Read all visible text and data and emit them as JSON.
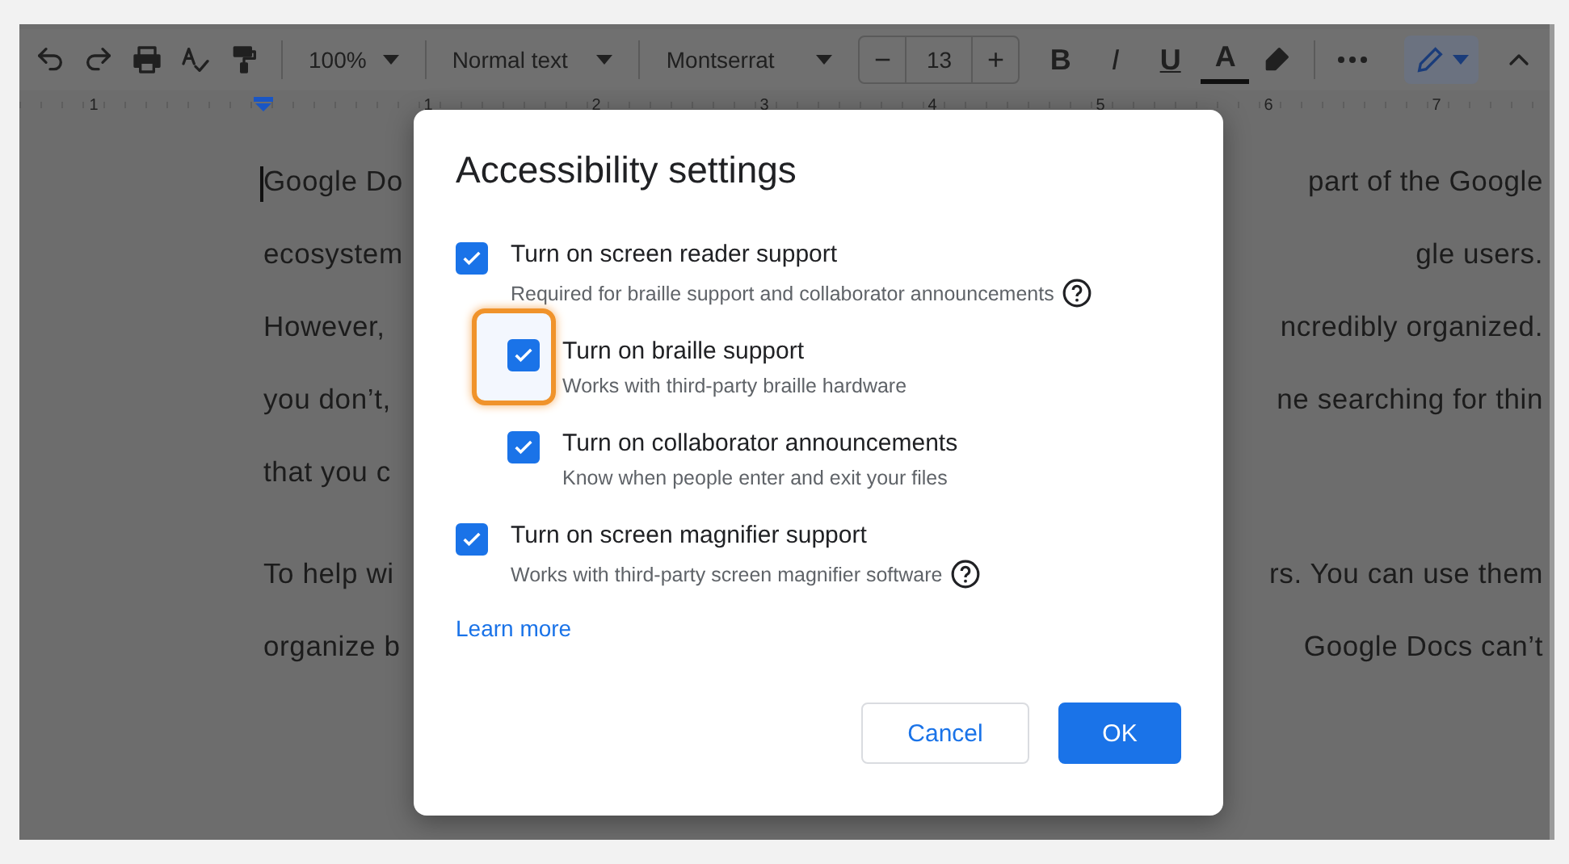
{
  "toolbar": {
    "zoom": "100%",
    "style": "Normal text",
    "font": "Montserrat",
    "font_size": {
      "minus": "−",
      "value": "13",
      "plus": "+"
    },
    "format_keys": [
      {
        "kind": "bold",
        "label": "B"
      },
      {
        "kind": "italic",
        "label": "I"
      },
      {
        "kind": "underline",
        "label": "U"
      },
      {
        "kind": "color",
        "label": "A"
      }
    ]
  },
  "ruler": {
    "numbers": [
      "1",
      "1",
      "2",
      "3",
      "4",
      "5",
      "6",
      "7"
    ]
  },
  "document": {
    "lines": [
      {
        "left": "Google Do",
        "right": "part of the Google",
        "cursor": true
      },
      {
        "left": "ecosystem",
        "right": "gle users.",
        "cursor": false
      },
      {
        "left": "However, ",
        "right": "ncredibly organized.",
        "cursor": false
      },
      {
        "left": "you don’t,",
        "right": "ne searching for thin",
        "cursor": false
      },
      {
        "left": "that you c",
        "cursor": false
      },
      {
        "left": "To help wi",
        "right": "rs. You can use them",
        "cursor": false,
        "para_gap": true
      },
      {
        "left": "organize b",
        "right": "Google Docs can’t",
        "cursor": false
      }
    ]
  },
  "dialog": {
    "title": "Accessibility settings",
    "options": [
      {
        "label": "Turn on screen reader support",
        "description": "Required for braille support and collaborator announcements",
        "checked": true,
        "help": true,
        "highlighted": false,
        "children": [
          {
            "label": "Turn on braille support",
            "description": "Works with third-party braille hardware",
            "checked": true,
            "help": false,
            "highlighted": true
          },
          {
            "label": "Turn on collaborator announcements",
            "description": "Know when people enter and exit your files",
            "checked": true,
            "help": false,
            "highlighted": false
          }
        ]
      },
      {
        "label": "Turn on screen magnifier support",
        "description": "Works with third-party screen magnifier software",
        "checked": true,
        "help": true,
        "highlighted": false
      }
    ],
    "link": "Learn more",
    "buttons": [
      {
        "kind": "secondary",
        "label": "Cancel"
      },
      {
        "kind": "primary",
        "label": "OK"
      }
    ]
  }
}
